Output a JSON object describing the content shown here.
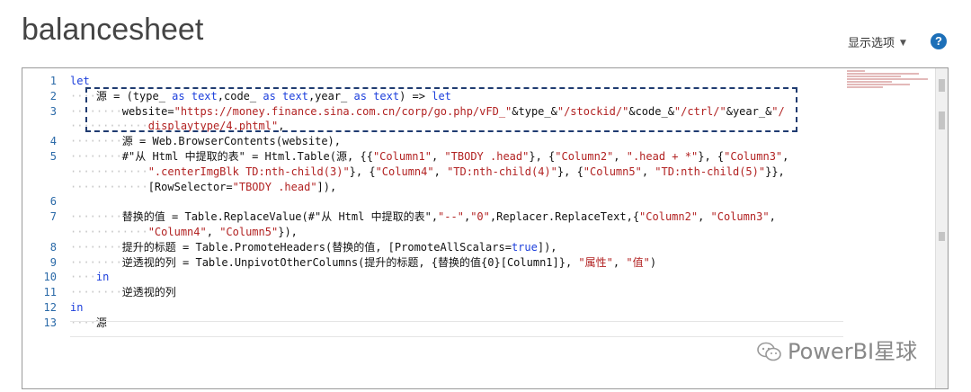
{
  "page": {
    "title": "balancesheet",
    "display_options_label": "显示选项",
    "help_label": "?"
  },
  "editor": {
    "line_numbers": [
      "1",
      "2",
      "3",
      "",
      "4",
      "5",
      "",
      "",
      "6",
      "7",
      "",
      "8",
      "9",
      "10",
      "11",
      "12",
      "13"
    ],
    "active_line": 13
  },
  "watermark": {
    "text": "PowerBI星球"
  },
  "colors": {
    "keyword": "#1c3fdc",
    "string": "#b22222",
    "line_number": "#2b6aa8",
    "highlight_border": "#1f3b70",
    "help_icon": "#1c6fb8"
  }
}
